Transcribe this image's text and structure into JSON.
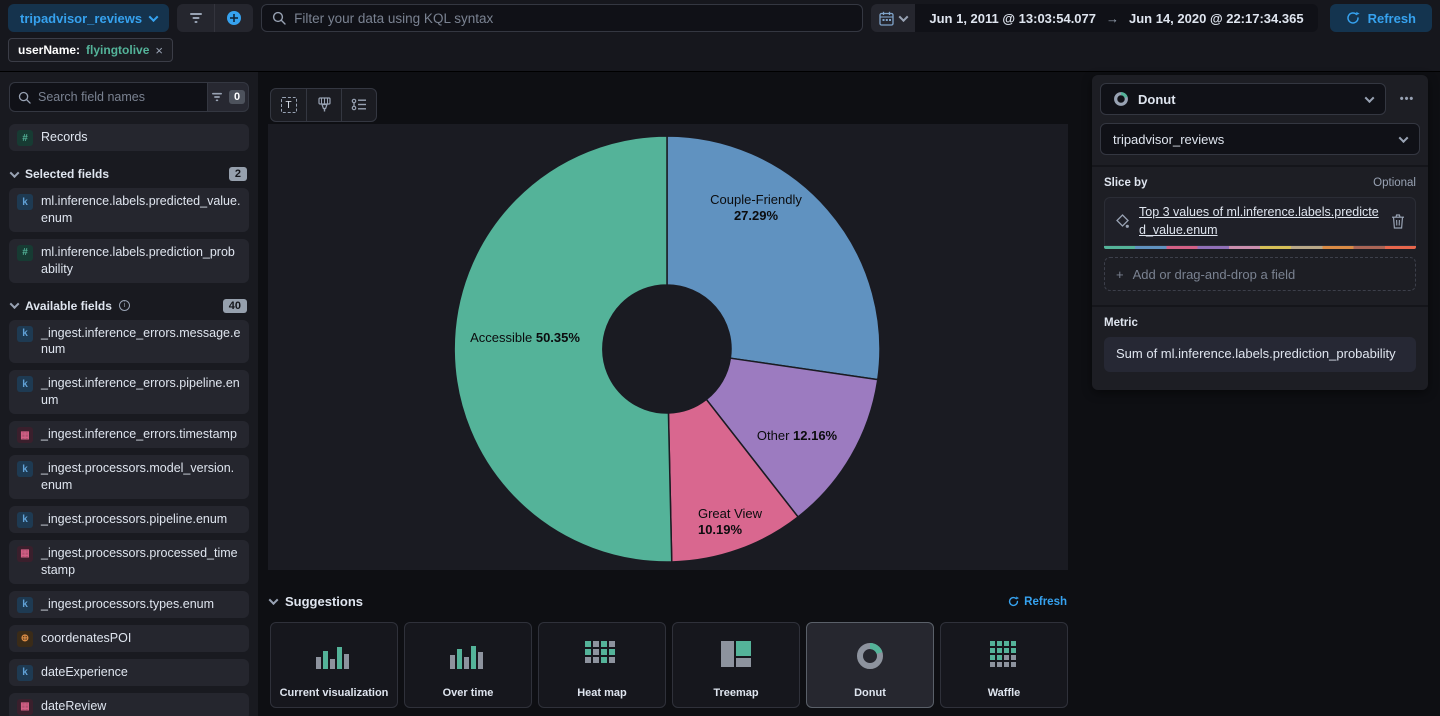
{
  "topbar": {
    "index_pattern": "tripadvisor_reviews",
    "kql_placeholder": "Filter your data using KQL syntax",
    "date_from": "Jun 1, 2011 @ 13:03:54.077",
    "date_to": "Jun 14, 2020 @ 22:17:34.365",
    "refresh_label": "Refresh"
  },
  "filter_pill": {
    "field": "userName:",
    "value": "flyingtolive"
  },
  "glyphs": {
    "close": "×",
    "arrow_right": "→",
    "plus": "+",
    "ellipsis": "•••",
    "labels_T": "T",
    "info": "i"
  },
  "sidebar": {
    "search_placeholder": "Search field names",
    "search_filter_count": "0",
    "records_label": "Records",
    "records_glyph": "#",
    "selected_header": "Selected fields",
    "selected_count": "2",
    "available_header": "Available fields",
    "available_count": "40",
    "selected_fields": [
      {
        "name": "ml.inference.labels.predicted_value.enum",
        "type": "keyword",
        "glyph": "k"
      },
      {
        "name": "ml.inference.labels.prediction_probability",
        "type": "number",
        "glyph": "#"
      }
    ],
    "available_fields": [
      {
        "name": "_ingest.inference_errors.message.enum",
        "type": "keyword",
        "glyph": "k"
      },
      {
        "name": "_ingest.inference_errors.pipeline.enum",
        "type": "keyword",
        "glyph": "k"
      },
      {
        "name": "_ingest.inference_errors.timestamp",
        "type": "date",
        "glyph": "▦"
      },
      {
        "name": "_ingest.processors.model_version.enum",
        "type": "keyword",
        "glyph": "k"
      },
      {
        "name": "_ingest.processors.pipeline.enum",
        "type": "keyword",
        "glyph": "k"
      },
      {
        "name": "_ingest.processors.processed_timestamp",
        "type": "date",
        "glyph": "▦"
      },
      {
        "name": "_ingest.processors.types.enum",
        "type": "keyword",
        "glyph": "k"
      },
      {
        "name": "coordenatesPOI",
        "type": "geo_point",
        "glyph": "⊕"
      },
      {
        "name": "dateExperience",
        "type": "keyword",
        "glyph": "k"
      },
      {
        "name": "dateReview",
        "type": "date",
        "glyph": "▦"
      }
    ]
  },
  "suggestions": {
    "header": "Suggestions",
    "refresh_label": "Refresh",
    "items": [
      "Current visualization",
      "Over time",
      "Heat map",
      "Treemap",
      "Donut",
      "Waffle"
    ],
    "selected": "Donut"
  },
  "config_panel": {
    "chart_type": "Donut",
    "data_view": "tripadvisor_reviews",
    "slice_by_label": "Slice by",
    "optional_label": "Optional",
    "dimension_label": "Top 3 values of ml.inference.labels.predicted_value.enum",
    "add_field_label": "Add or drag-and-drop a field",
    "metric_label": "Metric",
    "metric_value": "Sum of ml.inference.labels.prediction_probability",
    "palette_strip": [
      "#54B399",
      "#6092C0",
      "#D36086",
      "#9170B8",
      "#CA8EAE",
      "#D6BF57",
      "#B9A888",
      "#DA8B45",
      "#AA6556",
      "#E7664C"
    ]
  },
  "colors": {
    "accent_blue": "#36A2EF",
    "teal_green": "#54B399",
    "panel_bg": "#1D1E24",
    "page_bg": "#0E0F13"
  },
  "chart_data": {
    "type": "pie",
    "subtype": "donut",
    "slice_by": "Top 3 values of ml.inference.labels.predicted_value.enum",
    "metric": "Sum of ml.inference.labels.prediction_probability",
    "unit": "%",
    "start_angle_deg": 0,
    "clockwise": true,
    "legend": "hidden",
    "slices": [
      {
        "label": "Couple-Friendly",
        "value": 27.29,
        "pct_text": "27.29%",
        "color": "#6092C0"
      },
      {
        "label": "Other",
        "value": 12.16,
        "pct_text": "12.16%",
        "color": "#9C7BC0"
      },
      {
        "label": "Great View",
        "value": 10.19,
        "pct_text": "10.19%",
        "color": "#D9678F"
      },
      {
        "label": "Accessible",
        "value": 50.35,
        "pct_text": "50.35%",
        "color": "#54B399"
      }
    ]
  }
}
